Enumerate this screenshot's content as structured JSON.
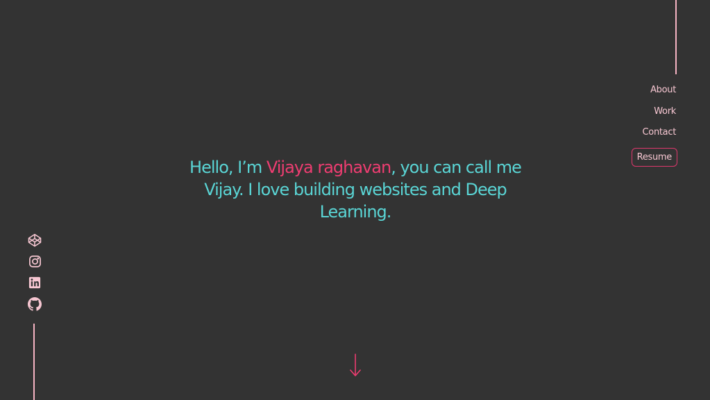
{
  "nav": {
    "about": "About",
    "work": "Work",
    "contact": "Contact",
    "resume": "Resume"
  },
  "hero": {
    "prefix": "Hello, I’m ",
    "name": "Vijaya raghavan",
    "suffix": ", you can call me Vijay. I love building websites and Deep Learning."
  },
  "socials": [
    {
      "icon": "codepen-icon"
    },
    {
      "icon": "instagram-icon"
    },
    {
      "icon": "linkedin-icon"
    },
    {
      "icon": "github-icon"
    }
  ],
  "colors": {
    "background": "#333333",
    "accent_pink": "#ee3d71",
    "text_cyan": "#5ad5d5",
    "line_pink": "#f7b4c3"
  }
}
